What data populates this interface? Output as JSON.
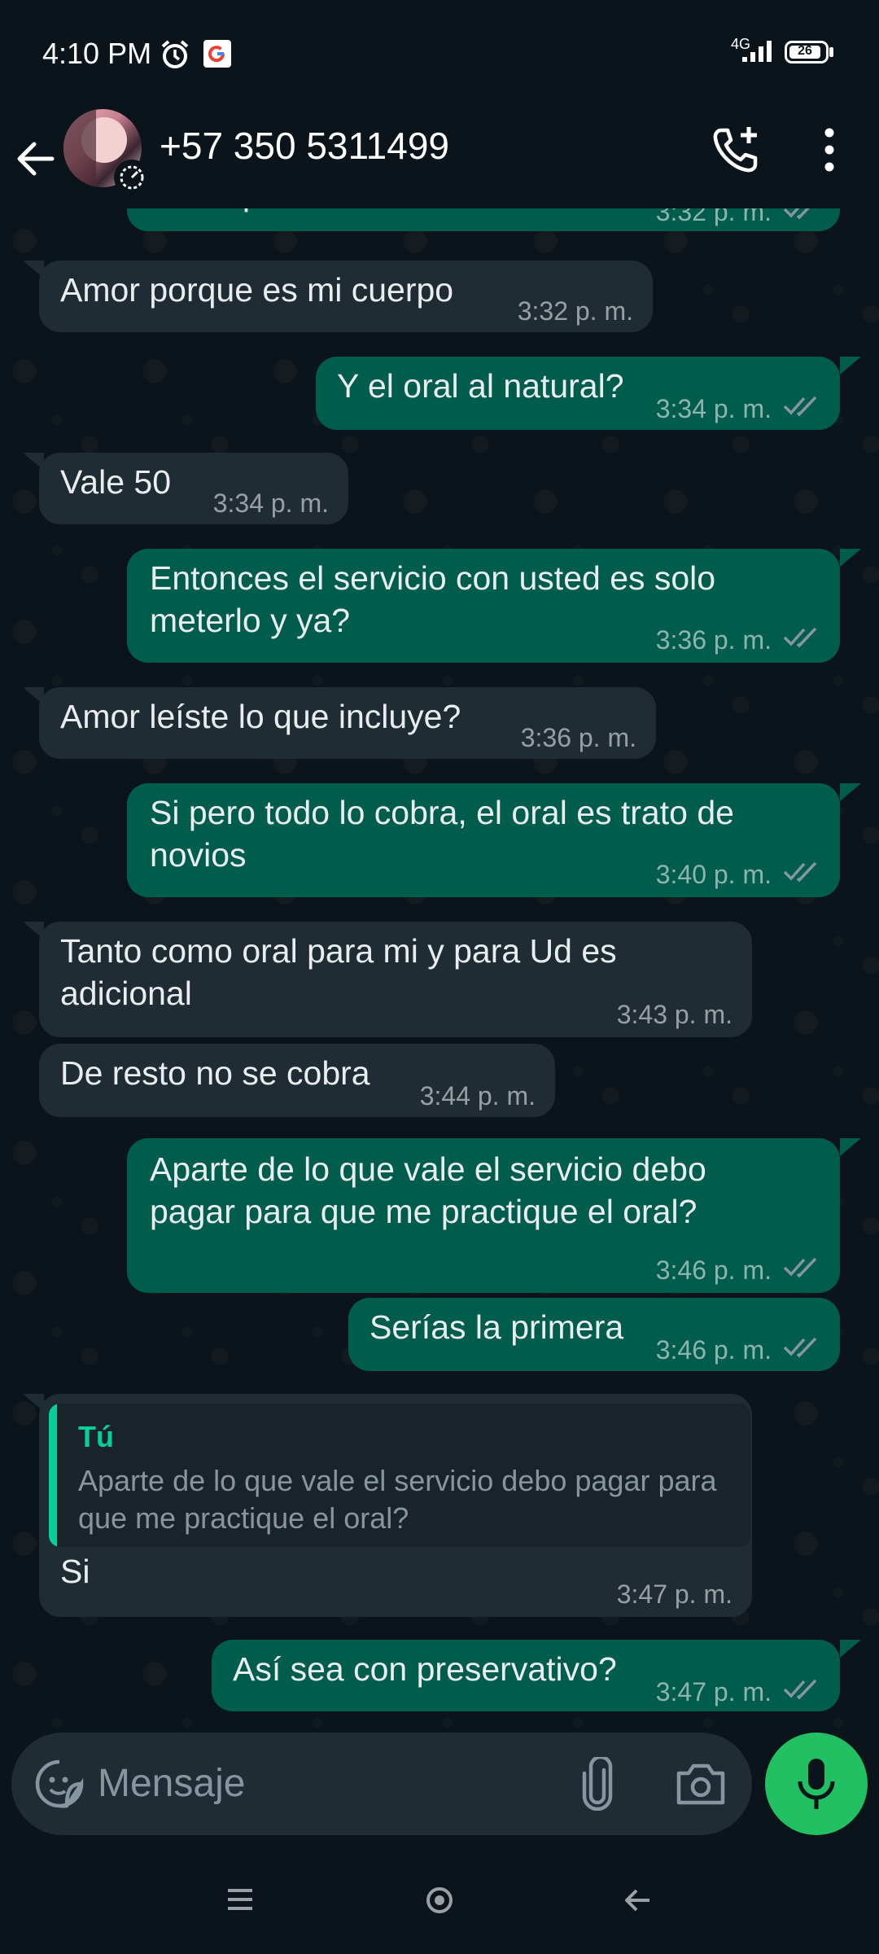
{
  "status_bar": {
    "time": "4:10 PM",
    "network": "4G",
    "battery": "26"
  },
  "header": {
    "contact_name": "+57 350 5311499"
  },
  "chat": {
    "partial_message": {
      "text": "tiene que esforzarse",
      "time": "3:32 p. m."
    },
    "messages": [
      {
        "direction": "in",
        "lines": [
          "Amor porque es mi cuerpo"
        ],
        "time": "3:32 p. m."
      },
      {
        "direction": "out",
        "lines": [
          "Y el oral al natural?"
        ],
        "time": "3:34 p. m."
      },
      {
        "direction": "in",
        "lines": [
          "Vale 50"
        ],
        "time": "3:34 p. m."
      },
      {
        "direction": "out",
        "lines": [
          "Entonces el servicio con usted es solo",
          "meterlo y ya?"
        ],
        "time": "3:36 p. m."
      },
      {
        "direction": "in",
        "lines": [
          "Amor leíste lo que incluye?"
        ],
        "time": "3:36 p. m."
      },
      {
        "direction": "out",
        "lines": [
          "Si pero todo lo cobra, el oral es trato de",
          "novios"
        ],
        "time": "3:40 p. m."
      },
      {
        "direction": "in",
        "lines": [
          "Tanto como oral para mi y para Ud es",
          "adicional"
        ],
        "time": "3:43 p. m."
      },
      {
        "direction": "in",
        "lines": [
          "De resto no se cobra"
        ],
        "time": "3:44 p. m."
      },
      {
        "direction": "out",
        "lines": [
          "Aparte de lo que vale el servicio debo",
          "pagar para que me practique el oral?"
        ],
        "time": "3:46 p. m."
      },
      {
        "direction": "out",
        "lines": [
          "Serías la primera"
        ],
        "time": "3:46 p. m."
      },
      {
        "direction": "in",
        "quoted_author": "Tú",
        "quoted_text": "Aparte de lo que vale el servicio debo pagar para que me practique el oral?",
        "lines": [
          "Si"
        ],
        "time": "3:47 p. m."
      },
      {
        "direction": "out",
        "lines": [
          "Así sea con preservativo?"
        ],
        "time": "3:47 p. m."
      }
    ]
  },
  "composer": {
    "placeholder": "Mensaje"
  },
  "colors": {
    "background": "#0b141a",
    "incoming_bubble": "#202c33",
    "outgoing_bubble": "#005c4b",
    "accent_green": "#21c063",
    "read_ticks": "#8696a0"
  }
}
